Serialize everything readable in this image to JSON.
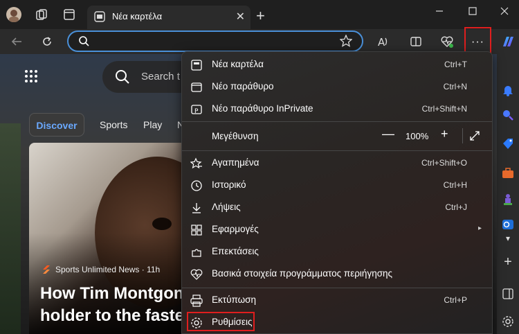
{
  "tab": {
    "title": "Νέα καρτέλα",
    "new_tab_symbol": "+"
  },
  "address": {
    "placeholder": ""
  },
  "page": {
    "search_placeholder": "Search t",
    "nav": [
      "Discover",
      "Sports",
      "Play",
      "N"
    ],
    "card": {
      "source": "Sports Unlimited News · 11h",
      "headline_line1": "How Tim Montgon",
      "headline_line2": "holder to the fastes"
    }
  },
  "menu": {
    "items": [
      {
        "label": "Νέα καρτέλα",
        "shortcut": "Ctrl+T",
        "icon": "new-tab-icon"
      },
      {
        "label": "Νέο παράθυρο",
        "shortcut": "Ctrl+N",
        "icon": "new-window-icon"
      },
      {
        "label": "Νέο παράθυρο InPrivate",
        "shortcut": "Ctrl+Shift+N",
        "icon": "inprivate-icon"
      },
      {
        "label": "Μεγέθυνση",
        "shortcut": "",
        "icon": ""
      },
      {
        "label": "Αγαπημένα",
        "shortcut": "Ctrl+Shift+O",
        "icon": "favorites-icon"
      },
      {
        "label": "Ιστορικό",
        "shortcut": "Ctrl+H",
        "icon": "history-icon"
      },
      {
        "label": "Λήψεις",
        "shortcut": "Ctrl+J",
        "icon": "downloads-icon"
      },
      {
        "label": "Εφαρμογές",
        "shortcut": "",
        "icon": "apps-icon"
      },
      {
        "label": "Επεκτάσεις",
        "shortcut": "",
        "icon": "extensions-icon"
      },
      {
        "label": "Βασικά στοιχεία προγράμματος περιήγησης",
        "shortcut": "",
        "icon": "essentials-icon"
      },
      {
        "label": "Εκτύπωση",
        "shortcut": "Ctrl+P",
        "icon": "print-icon"
      },
      {
        "label": "Ρυθμίσεις",
        "shortcut": "",
        "icon": "settings-icon"
      }
    ],
    "zoom": {
      "minus": "—",
      "value": "100%",
      "plus": "+"
    }
  },
  "colors": {
    "accent": "#4a90d9",
    "highlight": "#e01e1e",
    "menu_bg": "#2c2c2c"
  }
}
